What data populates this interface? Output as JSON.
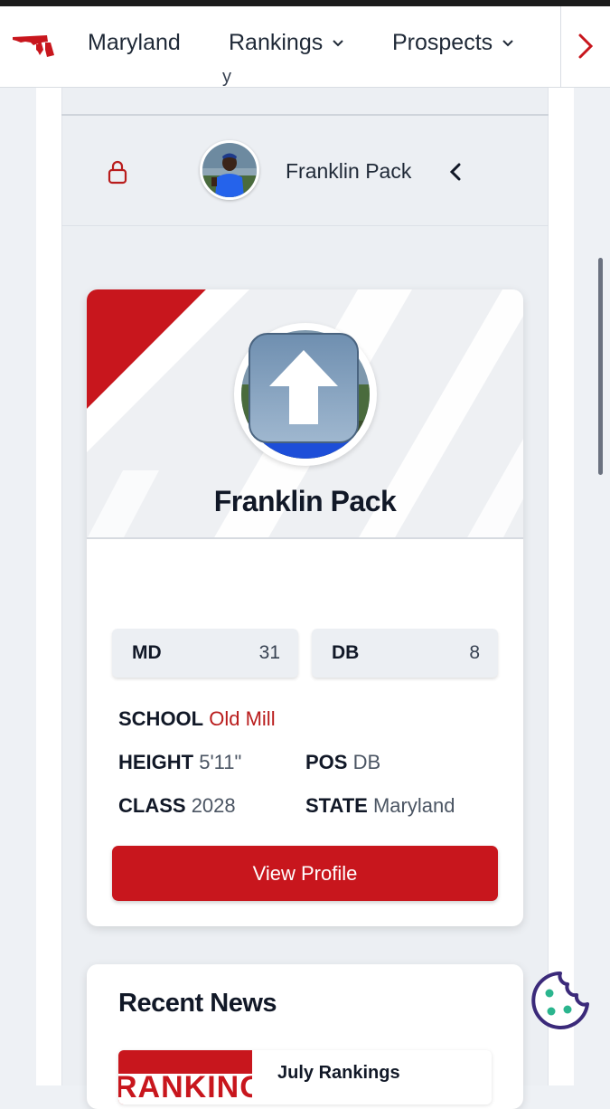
{
  "nav": {
    "logo_icon": "maryland-state-logo-icon",
    "items": [
      {
        "label": "Maryland"
      },
      {
        "label": "Rankings",
        "icon": "chevron-down-icon"
      },
      {
        "label": "Prospects",
        "icon": "chevron-down-icon"
      }
    ],
    "next_icon": "chevron-right-icon"
  },
  "header": {
    "cut_text": "y",
    "lock_icon": "lock-icon",
    "player_name": "Franklin Pack",
    "collapse_icon": "chevron-left-icon"
  },
  "card": {
    "player_name": "Franklin Pack",
    "upload_icon": "upload-arrow-icon",
    "ranks": [
      {
        "label": "MD",
        "value": "31"
      },
      {
        "label": "DB",
        "value": "8"
      }
    ],
    "school_label": "SCHOOL",
    "school_value": "Old Mill",
    "height_label": "HEIGHT",
    "height_value": "5'11\"",
    "pos_label": "POS",
    "pos_value": "DB",
    "class_label": "CLASS",
    "class_value": "2028",
    "state_label": "STATE",
    "state_value": "Maryland",
    "button_label": "View Profile"
  },
  "news": {
    "title": "Recent News",
    "items": [
      {
        "thumb_text": "RANKINGS",
        "title": "July Rankings"
      }
    ]
  },
  "cookie_icon": "cookie-icon",
  "colors": {
    "brand_red": "#c8161d",
    "accent_red_text": "#b91c1c",
    "cookie_purple": "#3b2a7a",
    "cookie_teal": "#2bb58e"
  }
}
